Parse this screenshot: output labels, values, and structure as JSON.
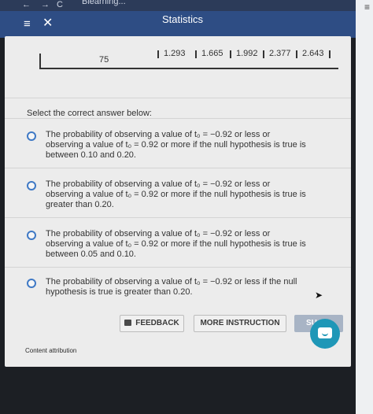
{
  "browser": {
    "back": "←",
    "forward": "→",
    "reload": "C",
    "tab_text": "Blearning..."
  },
  "header": {
    "menu_glyph": "≡",
    "close_glyph": "✕",
    "title": "Statistics"
  },
  "table": {
    "cells": [
      "75",
      "1.293",
      "1.665",
      "1.992",
      "2.377",
      "2.643"
    ]
  },
  "prompt": "Select the correct answer below:",
  "options": [
    {
      "line1": "The probability of observing a value of t₀ = −0.92 or less or",
      "line2": "observing a value of t₀ = 0.92 or more if the null hypothesis is true is",
      "line3": "between 0.10 and 0.20."
    },
    {
      "line1": "The probability of observing a value of t₀ = −0.92 or less or",
      "line2": "observing a value of t₀ = 0.92 or more if the null hypothesis is true is",
      "line3": "greater than 0.20."
    },
    {
      "line1": "The probability of observing a value of t₀ = −0.92 or less or",
      "line2": "observing a value of t₀ = 0.92 or more if the null hypothesis is true is",
      "line3": "between 0.05 and 0.10."
    },
    {
      "line1": "The probability of observing a value of t₀ = −0.92 or less if the null",
      "line2": "hypothesis is true is greater than 0.20.",
      "line3": ""
    }
  ],
  "buttons": {
    "feedback": "FEEDBACK",
    "more_instruction": "MORE INSTRUCTION",
    "submit": "SU"
  },
  "attribution": "Content attribution",
  "icons": {
    "feedback": "feedback-icon",
    "chat": "chat-icon",
    "radio": "radio-button-icon"
  },
  "colors": {
    "header": "#2e4d84",
    "radio": "#3f79c5",
    "chat": "#1f97b7"
  }
}
